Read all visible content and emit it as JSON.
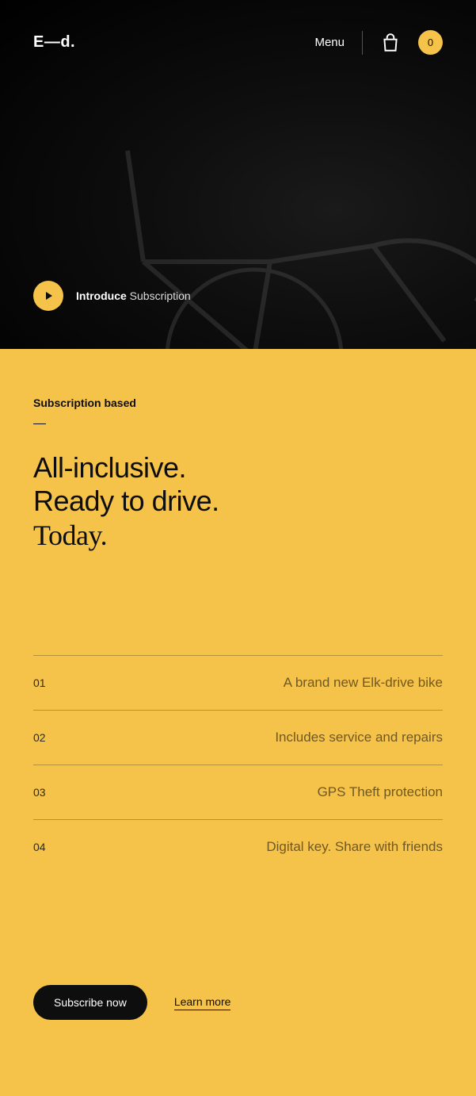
{
  "header": {
    "logo": "E—d.",
    "menu": "Menu",
    "cart_count": "0"
  },
  "hero": {
    "intro_bold": "Introduce",
    "intro_light": "Subscription"
  },
  "section": {
    "eyebrow": "Subscription based",
    "headline_l1": "All-inclusive.",
    "headline_l2": "Ready to drive.",
    "headline_l3": "Today."
  },
  "features": [
    {
      "num": "01",
      "text": "A brand new Elk-drive bike"
    },
    {
      "num": "02",
      "text": "Includes service and repairs"
    },
    {
      "num": "03",
      "text": "GPS Theft protection"
    },
    {
      "num": "04",
      "text": "Digital key. Share with friends"
    }
  ],
  "cta": {
    "primary": "Subscribe now",
    "secondary": "Learn more"
  }
}
